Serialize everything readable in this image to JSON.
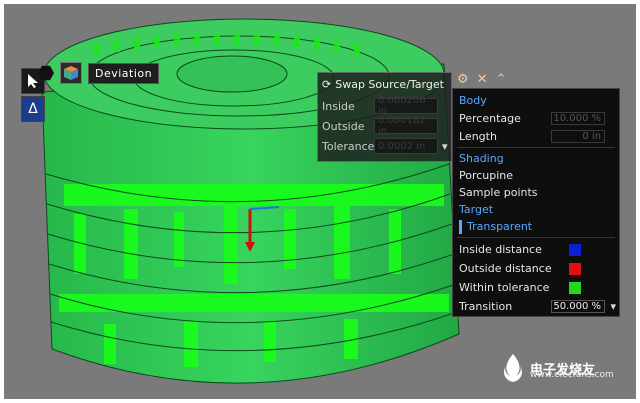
{
  "deviation_tool": {
    "label": "Deviation",
    "swap_label": "Swap Source/Target",
    "inside_label": "Inside",
    "inside_value": "0.000206 in",
    "outside_label": "Outside",
    "outside_value": "0.000182 in",
    "tolerance_label": "Tolerance",
    "tolerance_value": "0.0002 in"
  },
  "panel": {
    "body_header": "Body",
    "percentage_label": "Percentage",
    "percentage_value": "10.000 %",
    "length_label": "Length",
    "length_value": "0 in",
    "shading_header": "Shading",
    "porcupine_label": "Porcupine",
    "sample_points_label": "Sample points",
    "target_header": "Target",
    "transparent_label": "Transparent",
    "inside_distance_label": "Inside distance",
    "outside_distance_label": "Outside distance",
    "within_tolerance_label": "Within tolerance",
    "transition_label": "Transition",
    "transition_value": "50.000 %"
  },
  "colors": {
    "inside_distance": "#0b1fd6",
    "outside_distance": "#e01010",
    "within_tolerance": "#22d622",
    "model_base": "#2ec45a"
  },
  "icons": {
    "toolbar": [
      "cursor-icon",
      "delta-icon"
    ],
    "top": [
      "settings-icon",
      "close-icon",
      "collapse-icon"
    ]
  },
  "watermark": {
    "title": "电子发烧友",
    "subtitle": "www.elecfans.com"
  }
}
